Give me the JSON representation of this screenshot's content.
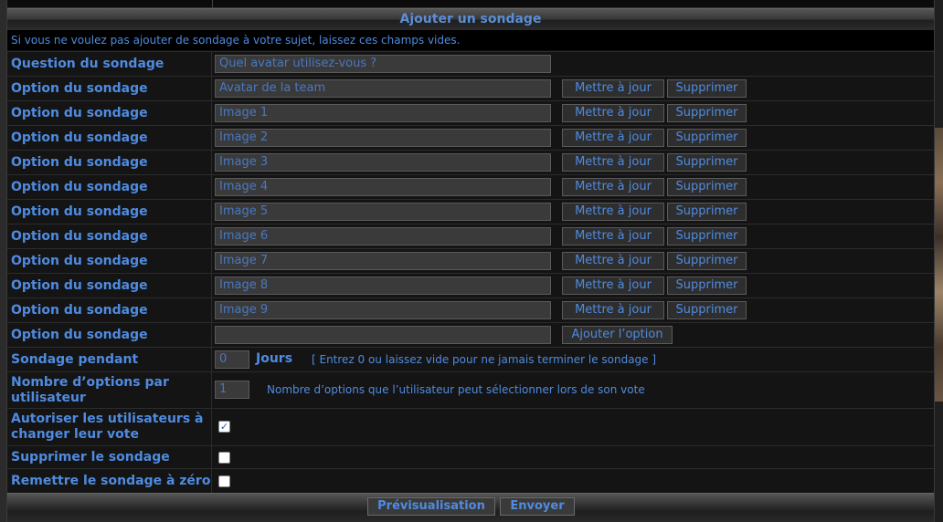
{
  "section": {
    "title": "Ajouter un sondage",
    "info": "Si vous ne voulez pas ajouter de sondage à votre sujet, laissez ces champs vides."
  },
  "question": {
    "label": "Question du sondage",
    "value": "Quel avatar utilisez-vous ?"
  },
  "options": [
    {
      "label": "Option du sondage",
      "value": "Avatar de la team",
      "update": "Mettre à jour",
      "delete": "Supprimer"
    },
    {
      "label": "Option du sondage",
      "value": "Image 1",
      "update": "Mettre à jour",
      "delete": "Supprimer"
    },
    {
      "label": "Option du sondage",
      "value": "Image 2",
      "update": "Mettre à jour",
      "delete": "Supprimer"
    },
    {
      "label": "Option du sondage",
      "value": "Image 3",
      "update": "Mettre à jour",
      "delete": "Supprimer"
    },
    {
      "label": "Option du sondage",
      "value": "Image 4",
      "update": "Mettre à jour",
      "delete": "Supprimer"
    },
    {
      "label": "Option du sondage",
      "value": "Image 5",
      "update": "Mettre à jour",
      "delete": "Supprimer"
    },
    {
      "label": "Option du sondage",
      "value": "Image 6",
      "update": "Mettre à jour",
      "delete": "Supprimer"
    },
    {
      "label": "Option du sondage",
      "value": "Image 7",
      "update": "Mettre à jour",
      "delete": "Supprimer"
    },
    {
      "label": "Option du sondage",
      "value": "Image 8",
      "update": "Mettre à jour",
      "delete": "Supprimer"
    },
    {
      "label": "Option du sondage",
      "value": "Image 9",
      "update": "Mettre à jour",
      "delete": "Supprimer"
    }
  ],
  "new_option": {
    "label": "Option du sondage",
    "value": "",
    "add": "Ajouter l’option"
  },
  "duration": {
    "label": "Sondage pendant",
    "value": "0",
    "unit": "Jours",
    "hint": "[ Entrez 0 ou laissez vide pour ne jamais terminer le sondage ]"
  },
  "max_options": {
    "label": "Nombre d’options par utilisateur",
    "value": "1",
    "hint": "Nombre d’options que l’utilisateur peut sélectionner lors de son vote"
  },
  "allow_change": {
    "label": "Autoriser les utilisateurs à changer leur vote",
    "checked": true,
    "mark": "✓"
  },
  "delete_poll": {
    "label": "Supprimer le sondage",
    "checked": false
  },
  "reset_poll": {
    "label": "Remettre le sondage à zéro",
    "checked": false
  },
  "footer": {
    "preview": "Prévisualisation",
    "submit": "Envoyer"
  },
  "colors": {
    "accent": "#4f8be0",
    "background": "#141414",
    "input_bg": "#3a3a3a"
  }
}
